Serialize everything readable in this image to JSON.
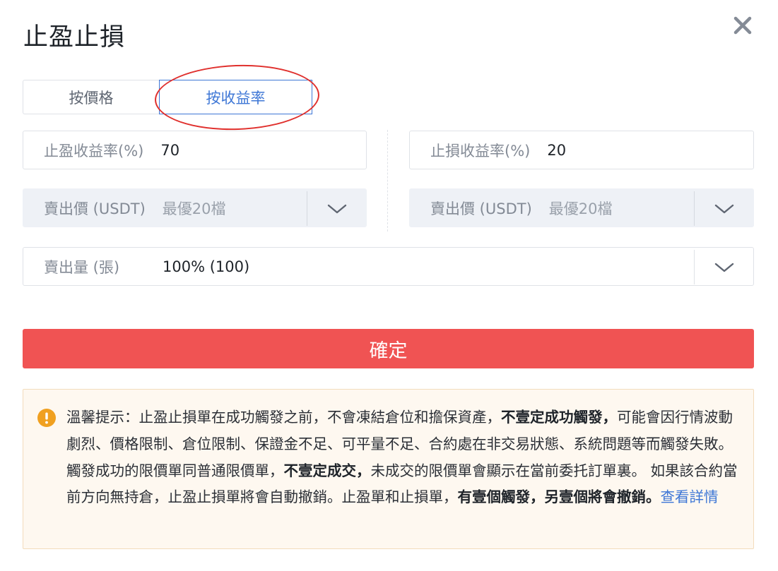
{
  "dialog": {
    "title": "止盈止損"
  },
  "tabs": [
    {
      "label": "按價格",
      "active": false
    },
    {
      "label": "按收益率",
      "active": true
    }
  ],
  "take_profit": {
    "label": "止盈收益率(%)",
    "value": "70",
    "price_label": "賣出價 (USDT)",
    "price_value": "最優20檔"
  },
  "stop_loss": {
    "label": "止損收益率(%)",
    "value": "20",
    "price_label": "賣出價 (USDT)",
    "price_value": "最優20檔"
  },
  "quantity": {
    "label": "賣出量 (張)",
    "value": "100% (100)"
  },
  "confirm_label": "確定",
  "notice": {
    "p1": "溫馨提示：止盈止損單在成功觸發之前，不會凍結倉位和擔保資產，",
    "b1": "不壹定成功觸發，",
    "p2": "可能會因行情波動劇烈、價格限制、倉位限制、保證金不足、可平量不足、合約處在非交易狀態、系統問題等而觸發失敗。觸發成功的限價單同普通限價單，",
    "b2": "不壹定成交，",
    "p3": "未成交的限價單會顯示在當前委托訂單裏。 如果該合約當前方向無持倉，止盈止損單將會自動撤銷。止盈單和止損單，",
    "b3": "有壹個觸發，另壹個將會撤銷。",
    "link": "查看詳情"
  },
  "colors": {
    "accent_blue": "#3e77d6",
    "confirm_red": "#f05353",
    "highlight_circle": "#e0302d",
    "warning_orange": "#f0a020"
  },
  "icons": [
    "close-icon",
    "chevron-down-icon",
    "warning-icon"
  ]
}
